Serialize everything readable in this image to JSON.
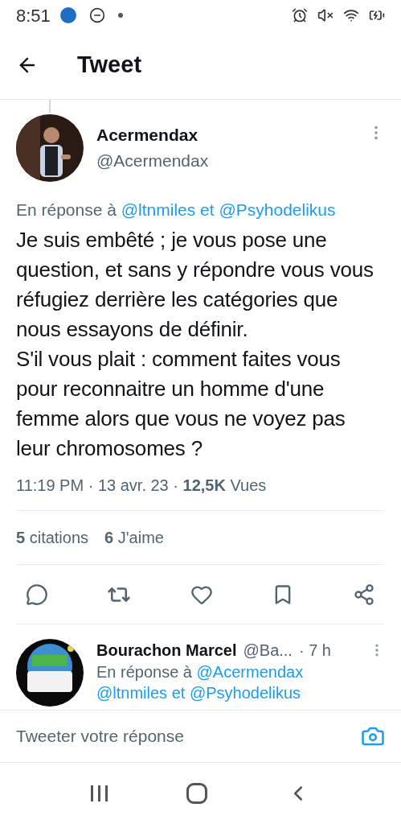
{
  "status_bar": {
    "time": "8:51"
  },
  "header": {
    "title": "Tweet"
  },
  "tweet": {
    "name": "Acermendax",
    "handle": "@Acermendax",
    "reply_to": {
      "label": "En réponse à",
      "mentions": "@ltnmiles et @Psyhodelikus"
    },
    "paragraphs": [
      "Je suis embêté ; je vous pose une question, et sans y répondre vous vous réfugiez derrière les catégories que nous essayons de définir.",
      "S'il vous plait : comment faites vous pour reconnaitre un homme d'une femme alors que vous ne voyez pas leur chromosomes ?"
    ],
    "meta": "11:19 PM · 13 avr. 23 · **12,5K** Vues",
    "stats": [
      "**5** citations",
      "**6** J'aime"
    ]
  },
  "reply": {
    "name": "Bourachon Marcel",
    "handle": "@Ba...",
    "time": "· 7 h",
    "reply_to": {
      "label": "En réponse à",
      "mentions": [
        "@Acermendax",
        "@ltnmiles et @Psyhodelikus"
      ]
    }
  },
  "compose": {
    "placeholder": "Tweeter votre réponse"
  }
}
